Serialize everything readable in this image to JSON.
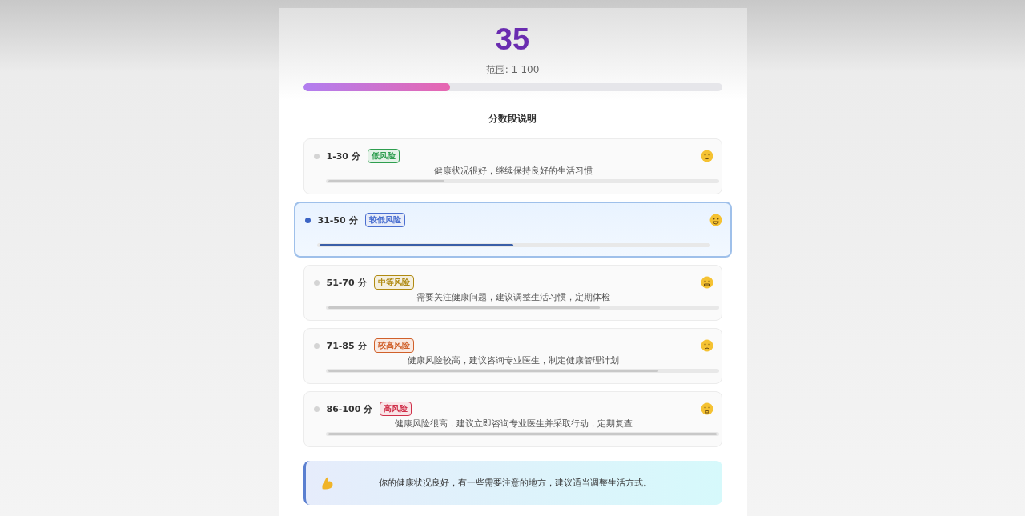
{
  "score": {
    "value": "35",
    "range": "范围: 1-100",
    "level": 0.35
  },
  "section_title": "分数段说明",
  "bands": [
    {
      "range": "1-30 分",
      "tag": "低风险",
      "color": "#2e9e4f",
      "description": "健康状况很好，继续保持良好的生活习惯",
      "level": 0.3,
      "selected": false
    },
    {
      "range": "31-50 分",
      "tag": "较低风险",
      "color": "#4a6fd0",
      "level": 0.5,
      "selected": true
    },
    {
      "range": "51-70 分",
      "tag": "中等风险",
      "color": "#b08a12",
      "description": "需要关注健康问题，建议调整生活习惯，定期体检",
      "level": 0.7,
      "selected": false
    },
    {
      "range": "71-85 分",
      "tag": "较高风险",
      "color": "#d0602a",
      "description": "健康风险较高，建议咨询专业医生，制定健康管理计划",
      "level": 0.85,
      "selected": false
    },
    {
      "range": "86-100 分",
      "tag": "高风险",
      "color": "#d0304a",
      "description": "健康风险很高，建议立即咨询专业医生并采取行动，定期复查",
      "level": 1,
      "selected": false
    }
  ],
  "advice": "你的健康状况良好，有一些需要注意的地方，建议适当调整生活方式。"
}
